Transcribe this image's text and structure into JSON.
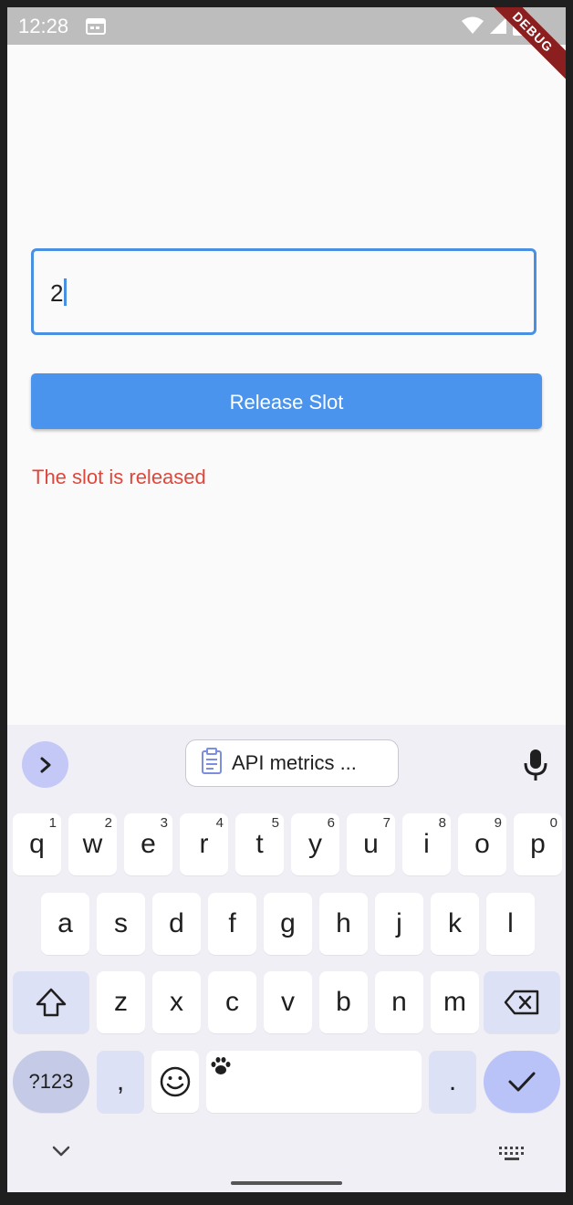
{
  "status_bar": {
    "time": "12:28",
    "debug_label": "DEBUG"
  },
  "form": {
    "slot_value": "2",
    "button_label": "Release Slot",
    "message": "The slot is released"
  },
  "keyboard": {
    "clipboard_chip": "API metrics ...",
    "row1": [
      {
        "key": "q",
        "hint": "1"
      },
      {
        "key": "w",
        "hint": "2"
      },
      {
        "key": "e",
        "hint": "3"
      },
      {
        "key": "r",
        "hint": "4"
      },
      {
        "key": "t",
        "hint": "5"
      },
      {
        "key": "y",
        "hint": "6"
      },
      {
        "key": "u",
        "hint": "7"
      },
      {
        "key": "i",
        "hint": "8"
      },
      {
        "key": "o",
        "hint": "9"
      },
      {
        "key": "p",
        "hint": "0"
      }
    ],
    "row2": [
      "a",
      "s",
      "d",
      "f",
      "g",
      "h",
      "j",
      "k",
      "l"
    ],
    "row3": [
      "z",
      "x",
      "c",
      "v",
      "b",
      "n",
      "m"
    ],
    "symbols_label": "?123",
    "comma": ",",
    "period": "."
  },
  "colors": {
    "accent": "#4a94ee",
    "error": "#e0463a",
    "keyboard_bg": "#f1eff6"
  }
}
